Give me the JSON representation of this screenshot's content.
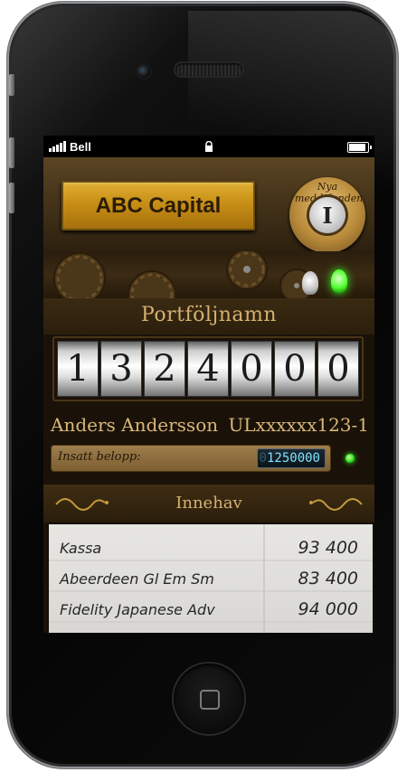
{
  "status_bar": {
    "carrier": "Bell"
  },
  "header": {
    "company_name": "ABC Capital",
    "messages_dial": {
      "label": "Nya meddelanden",
      "symbol": "I"
    }
  },
  "portfolio": {
    "title": "Portföljnamn",
    "digits": [
      "1",
      "3",
      "2",
      "4",
      "0",
      "0",
      "0"
    ],
    "owner": "Anders Andersson",
    "account_id": "ULxxxxxx123-1"
  },
  "deposit": {
    "label": "Insatt belopp:",
    "display_ghost": "0",
    "display_value": "1250000"
  },
  "holdings": {
    "title": "Innehav",
    "rows": [
      {
        "name": "Kassa",
        "value": "93 400"
      },
      {
        "name": "Abeerdeen Gl Em Sm",
        "value": "83 400"
      },
      {
        "name": "Fidelity Japanese Adv",
        "value": "94 000"
      }
    ]
  },
  "colors": {
    "plate_gold": "#c88e16",
    "text_gold": "#d6b070",
    "led_green": "#2ee51c",
    "lcd_cyan": "#7fe4ff"
  },
  "icons": [
    "signal-bars-icon",
    "lock-icon",
    "battery-icon",
    "bulb-icon",
    "led-indicator-icon",
    "home-square-icon"
  ]
}
